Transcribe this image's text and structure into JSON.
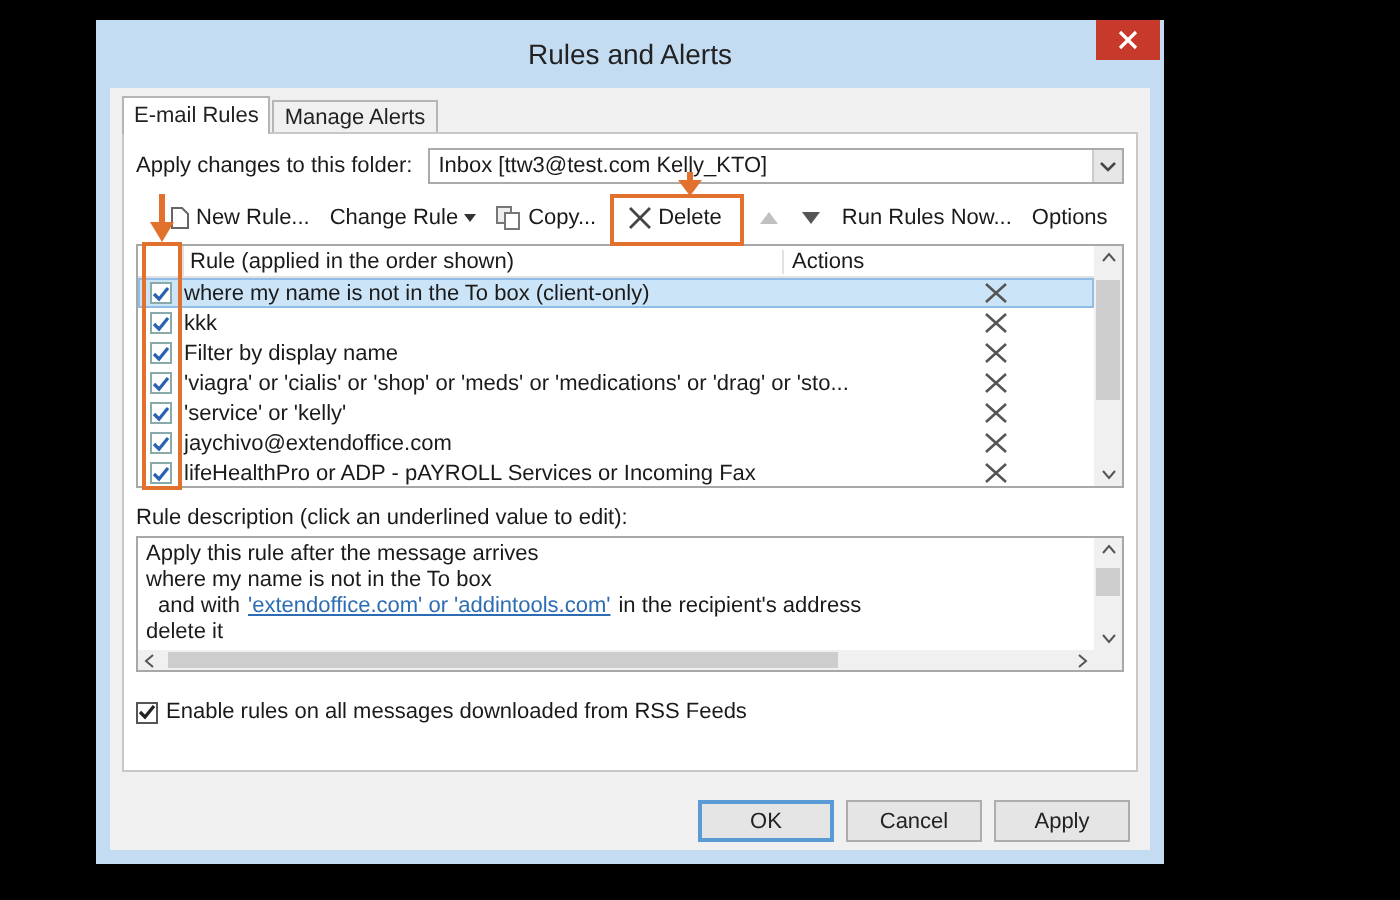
{
  "window": {
    "title": "Rules and Alerts"
  },
  "tabs": [
    {
      "label": "E-mail Rules",
      "selected": true
    },
    {
      "label": "Manage Alerts",
      "selected": false
    }
  ],
  "folder": {
    "label": "Apply changes to this folder:",
    "value": "Inbox [ttw3@test.com Kelly_KTO]"
  },
  "toolbar": [
    {
      "kind": "new",
      "label": "New Rule...",
      "disabled": false
    },
    {
      "kind": "menu",
      "label": "Change Rule",
      "disabled": false
    },
    {
      "kind": "copy",
      "label": "Copy...",
      "disabled": false
    },
    {
      "kind": "delete",
      "label": "Delete",
      "disabled": false
    },
    {
      "kind": "up",
      "disabled": true
    },
    {
      "kind": "down",
      "disabled": false
    },
    {
      "kind": "text",
      "label": "Run Rules Now...",
      "disabled": false
    },
    {
      "kind": "text",
      "label": "Options",
      "disabled": false
    }
  ],
  "table": {
    "columns": [
      "Rule (applied in the order shown)",
      "Actions"
    ],
    "rows": [
      {
        "rule": "where my name is not in the To box  (client-only)",
        "checked": true,
        "selected": true
      },
      {
        "rule": "kkk",
        "checked": true,
        "selected": false
      },
      {
        "rule": "Filter by display name",
        "checked": true,
        "selected": false
      },
      {
        "rule": "'viagra' or 'cialis' or 'shop' or 'meds' or 'medications' or 'drag' or 'sto...",
        "checked": true,
        "selected": false
      },
      {
        "rule": "'service' or 'kelly'",
        "checked": true,
        "selected": false
      },
      {
        "rule": "jaychivo@extendoffice.com",
        "checked": true,
        "selected": false
      },
      {
        "rule": "lifeHealthPro or ADP - pAYROLL Services or Incoming Fax",
        "checked": true,
        "selected": false
      }
    ]
  },
  "description": {
    "label": "Rule description (click an underlined value to edit):",
    "lines": [
      {
        "text": "Apply this rule after the message arrives",
        "indent": false
      },
      {
        "text": "where my name is not in the To box",
        "indent": false
      },
      {
        "text": "and with",
        "link": "'extendoffice.com' or 'addintools.com'",
        "after": "in the recipient's address",
        "indent": true
      },
      {
        "text": "delete it",
        "indent": false
      }
    ]
  },
  "rss": {
    "label": "Enable rules on all messages downloaded from RSS Feeds",
    "checked": true
  },
  "buttons": [
    {
      "label": "OK",
      "default": true
    },
    {
      "label": "Cancel",
      "default": false
    },
    {
      "label": "Apply",
      "default": false
    }
  ]
}
